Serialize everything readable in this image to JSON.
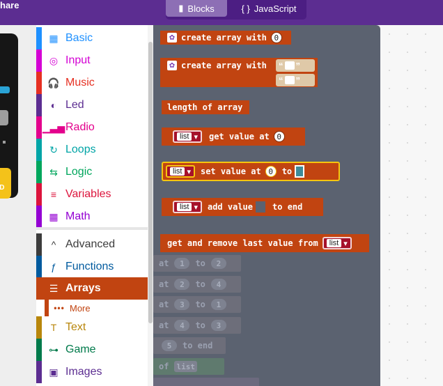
{
  "header": {
    "share_partial": "hare",
    "blocks_label": "Blocks",
    "javascript_label": "JavaScript"
  },
  "simulator": {
    "gnd_partial": "ND"
  },
  "toolbox": {
    "items": [
      {
        "label": "Basic",
        "icon": "grid-icon",
        "glyph": "▦",
        "color": "#1e90ff"
      },
      {
        "label": "Input",
        "icon": "target-icon",
        "glyph": "◎",
        "color": "#d400d4"
      },
      {
        "label": "Music",
        "icon": "headphones-icon",
        "glyph": "🎧",
        "color": "#e63022"
      },
      {
        "label": "Led",
        "icon": "toggle-icon",
        "glyph": "◐",
        "color": "#5c2d91"
      },
      {
        "label": "Radio",
        "icon": "signal-icon",
        "glyph": "▁▃▅",
        "color": "#e3008c"
      },
      {
        "label": "Loops",
        "icon": "refresh-icon",
        "glyph": "↻",
        "color": "#00a4a6"
      },
      {
        "label": "Logic",
        "icon": "shuffle-icon",
        "glyph": "⇆",
        "color": "#00a65c"
      },
      {
        "label": "Variables",
        "icon": "list-icon",
        "glyph": "≡",
        "color": "#dc143c"
      },
      {
        "label": "Math",
        "icon": "calculator-icon",
        "glyph": "▦",
        "color": "#9400d3"
      },
      {
        "label": "Advanced",
        "icon": "chevron-up-icon",
        "glyph": "^",
        "color": "#3c3c3c"
      },
      {
        "label": "Functions",
        "icon": "function-icon",
        "glyph": "ƒ",
        "color": "#005a9e"
      },
      {
        "label": "Arrays",
        "icon": "array-list-icon",
        "glyph": "☰",
        "color": "#c14411",
        "selected": true
      },
      {
        "label": "Text",
        "icon": "text-icon",
        "glyph": "T",
        "color": "#b8860b"
      },
      {
        "label": "Game",
        "icon": "gamepad-icon",
        "glyph": "⊶",
        "color": "#007a4b"
      },
      {
        "label": "Images",
        "icon": "image-icon",
        "glyph": "▣",
        "color": "#5c2d91"
      }
    ],
    "more_label": "More"
  },
  "flyout": {
    "create_array_with": "create array with",
    "zero": "0",
    "length_of_array": "length of array",
    "list": "list",
    "get_value_at": "get value at",
    "set_value_at": "set value at",
    "to": "to",
    "add_value": "add value",
    "to_end": "to end",
    "get_and_remove": "get and remove last value from",
    "quote_open": "“",
    "quote_close": "”",
    "ghost": {
      "at": "at",
      "to": "to",
      "to_end": "to end",
      "of": "of",
      "list": "list",
      "rows": [
        {
          "a": "1",
          "b": "2"
        },
        {
          "a": "2",
          "b": "4"
        },
        {
          "a": "3",
          "b": "1"
        },
        {
          "a": "4",
          "b": "3"
        }
      ],
      "five": "5"
    }
  },
  "colors": {
    "header": "#5c2d91",
    "arrays_block": "#c14411",
    "flyout_bg": "#5b6270",
    "list_variable": "#a6112b"
  }
}
